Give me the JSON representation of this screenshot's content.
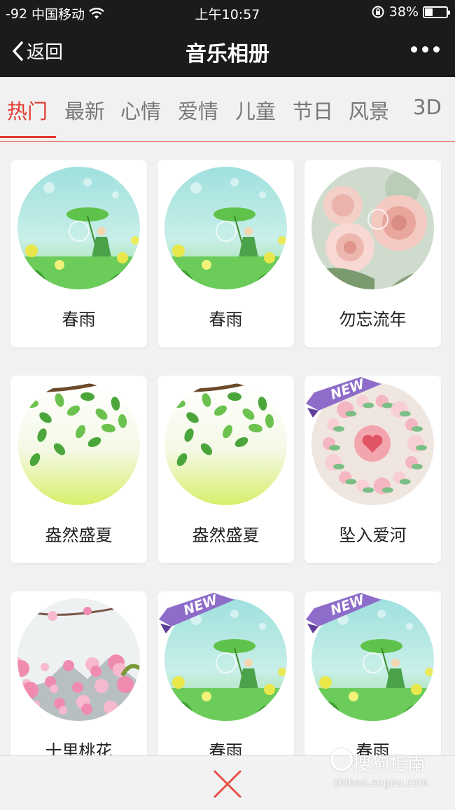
{
  "statusbar": {
    "signal": "-92",
    "carrier": "中国移动",
    "time": "上午10:57",
    "battery_text": "38%",
    "battery_level": 0.38
  },
  "navbar": {
    "back_label": "返回",
    "title": "音乐相册",
    "more_icon": "ellipsis-icon"
  },
  "tabs": [
    {
      "label": "热门",
      "active": true
    },
    {
      "label": "最新",
      "active": false
    },
    {
      "label": "心情",
      "active": false
    },
    {
      "label": "爱情",
      "active": false
    },
    {
      "label": "儿童",
      "active": false
    },
    {
      "label": "节日",
      "active": false
    },
    {
      "label": "风景",
      "active": false
    },
    {
      "label": "3D",
      "active": false
    }
  ],
  "albums": [
    {
      "name": "春雨",
      "theme": "spring-rain",
      "is_new": false
    },
    {
      "name": "春雨",
      "theme": "spring-rain",
      "is_new": false
    },
    {
      "name": "勿忘流年",
      "theme": "roses",
      "is_new": false
    },
    {
      "name": "盎然盛夏",
      "theme": "summer-leaves",
      "is_new": false
    },
    {
      "name": "盎然盛夏",
      "theme": "summer-leaves",
      "is_new": false
    },
    {
      "name": "坠入爱河",
      "theme": "flower-wreath",
      "is_new": true
    },
    {
      "name": "十里桃花",
      "theme": "peach-blossom",
      "is_new": false
    },
    {
      "name": "春雨",
      "theme": "spring-rain",
      "is_new": true
    },
    {
      "name": "春雨",
      "theme": "spring-rain",
      "is_new": true
    }
  ],
  "badge_text": "NEW",
  "bottombar": {
    "close_icon": "close-x-icon"
  },
  "watermark": {
    "main": "搜狗指南",
    "sub": "zhinan.sogou.com"
  },
  "colors": {
    "accent": "#e23a2e",
    "header_bg": "#1b1b1d",
    "badge": "#8e6cc9"
  }
}
